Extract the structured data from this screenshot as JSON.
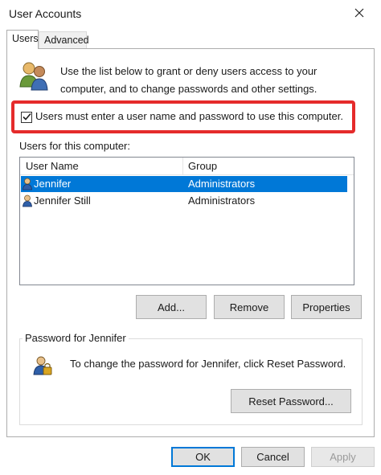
{
  "window": {
    "title": "User Accounts",
    "close_icon": "close-icon"
  },
  "tabs": [
    {
      "label": "Users",
      "active": true
    },
    {
      "label": "Advanced",
      "active": false
    }
  ],
  "intro": {
    "text": "Use the list below to grant or deny users access to your computer, and to change passwords and other settings.",
    "icon": "users-icon"
  },
  "require_login": {
    "label": "Users must enter a user name and password to use this computer.",
    "checked": true,
    "highlight_color": "#e52b2b"
  },
  "users_list": {
    "label": "Users for this computer:",
    "columns": [
      "User Name",
      "Group"
    ],
    "rows": [
      {
        "name": "Jennifer",
        "group": "Administrators",
        "selected": true
      },
      {
        "name": "Jennifer Still",
        "group": "Administrators",
        "selected": false
      }
    ],
    "selection_color": "#0078d7"
  },
  "actions": {
    "add": "Add...",
    "remove": "Remove",
    "properties": "Properties"
  },
  "password_group": {
    "title": "Password for Jennifer",
    "text": "To change the password for Jennifer, click Reset Password.",
    "reset": "Reset Password...",
    "icon": "password-icon"
  },
  "footer": {
    "ok": "OK",
    "cancel": "Cancel",
    "apply": "Apply"
  }
}
